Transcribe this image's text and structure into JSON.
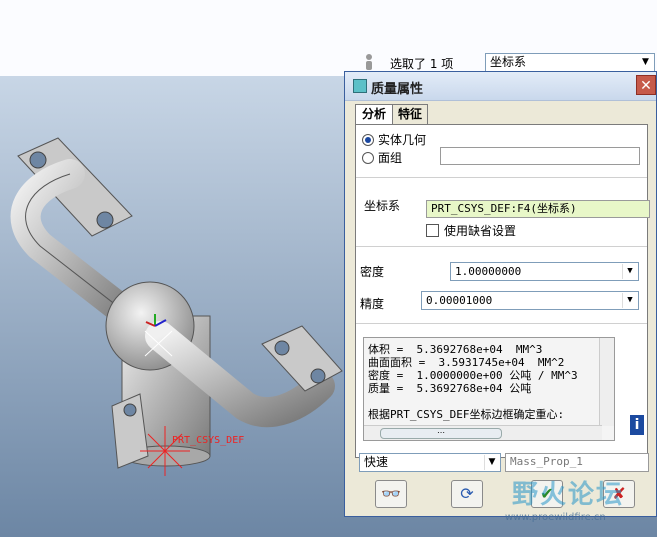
{
  "toolbar": {
    "selection_status": "选取了 1 项",
    "filter_value": "坐标系"
  },
  "model": {
    "csys_label": "PRT_CSYS_DEF"
  },
  "dialog": {
    "title": "质量属性",
    "close_glyph": "✕",
    "tabs": [
      {
        "label": "分析",
        "active": true
      },
      {
        "label": "特征",
        "active": false
      }
    ],
    "geometry_options": [
      {
        "label": "实体几何",
        "selected": true
      },
      {
        "label": "面组",
        "selected": false
      }
    ],
    "quilt_value": "",
    "csys_label": "坐标系",
    "csys_value": "PRT_CSYS_DEF:F4(坐标系)",
    "use_default_label": "使用缺省设置",
    "density_label": "密度",
    "density_value": "1.00000000",
    "accuracy_label": "精度",
    "accuracy_value": "0.00001000",
    "results": [
      "体积 =  5.3692768e+04  MM^3",
      "曲面面积 =  3.5931745e+04  MM^2",
      "密度 =  1.0000000e+00 公吨 / MM^3",
      "质量 =  5.3692768e+04 公吨",
      "",
      "根据PRT_CSYS_DEF坐标边框确定重心:"
    ],
    "info_glyph": "i",
    "mode_value": "快速",
    "feature_name_value": "Mass_Prop_1",
    "buttons": {
      "preview": "👓",
      "repeat": "⟳",
      "ok": "✔",
      "cancel": "✘"
    }
  },
  "watermark": {
    "title": "野火论坛",
    "url": "www.proewildfire.cn"
  }
}
